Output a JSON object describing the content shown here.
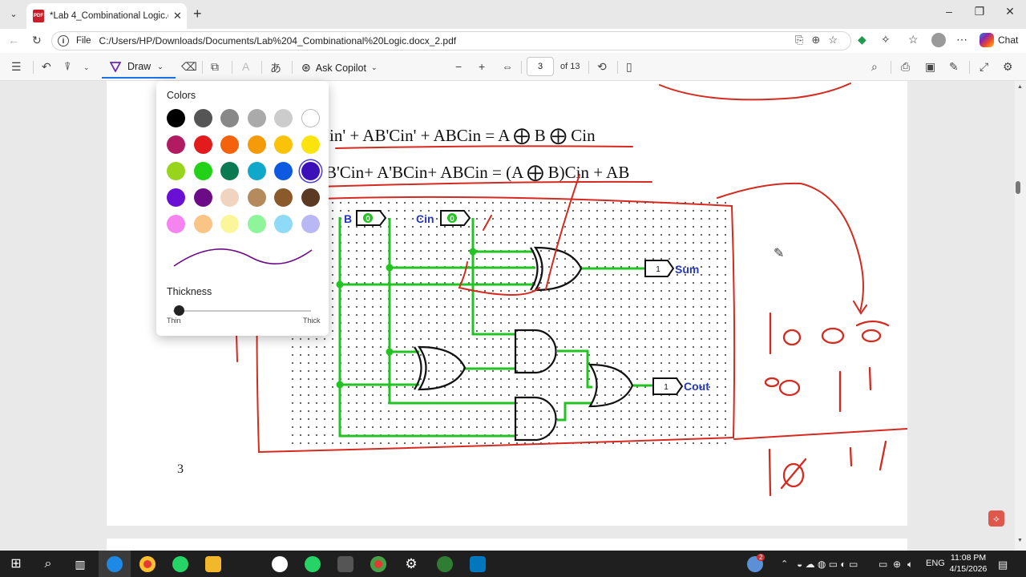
{
  "browser": {
    "tab_title": "*Lab 4_Combinational Logic.docx_2.pdf",
    "address_prefix": "File",
    "url": "C:/Users/HP/Downloads/Documents/Lab%204_Combinational%20Logic.docx_2.pdf",
    "chat_label": "Chat"
  },
  "pdf_toolbar": {
    "draw_label": "Draw",
    "ask_copilot_label": "Ask Copilot",
    "current_page": "3",
    "page_count": "of 13"
  },
  "document": {
    "eq1": "in' + AB'Cin' + ABCin = A ⨁ B ⨁ Cin",
    "eq2": "B'Cin+ A'BCin+ ABCin = (A ⨁ B)Cin + AB",
    "page_number": "3",
    "circuit": {
      "input_b_label": "B",
      "input_cin_label": "Cin",
      "input_value": "0",
      "output_sum_label": "Sum",
      "output_cout_label": "Cout",
      "output_value": "1",
      "wire_color": "#22c322"
    },
    "annotation_color": "#d42a20",
    "handwritten_marks": [
      "1",
      "0",
      "0",
      "0",
      "0",
      "0",
      "1",
      "1",
      "1",
      "0",
      "1",
      "1"
    ]
  },
  "draw_panel": {
    "colors_title": "Colors",
    "colors": [
      "#000000",
      "#555555",
      "#888888",
      "#aaaaaa",
      "#cccccc",
      "#ffffff",
      "#b01b62",
      "#e21c1c",
      "#f5620c",
      "#f59b0a",
      "#fac30a",
      "#fbe30e",
      "#96d51b",
      "#23d119",
      "#0b7a52",
      "#10a8c8",
      "#0d5ae0",
      "#3b10b8",
      "#6a10d4",
      "#6b0c86",
      "#f1d4c0",
      "#b58b5e",
      "#8a5a2a",
      "#5a3a22",
      "#f684f0",
      "#fbc487",
      "#fcf69a",
      "#8ef59a",
      "#8fdaf6",
      "#b9b8f5"
    ],
    "selected_color": "#3b10b8",
    "preview_stroke_color": "#6b0c86",
    "thickness_title": "Thickness",
    "thin_label": "Thin",
    "thick_label": "Thick",
    "thickness_value": 0.0
  },
  "taskbar": {
    "language": "ENG",
    "time": "11:08 PM",
    "date": "4/15/2026",
    "weather_badge": "2"
  }
}
